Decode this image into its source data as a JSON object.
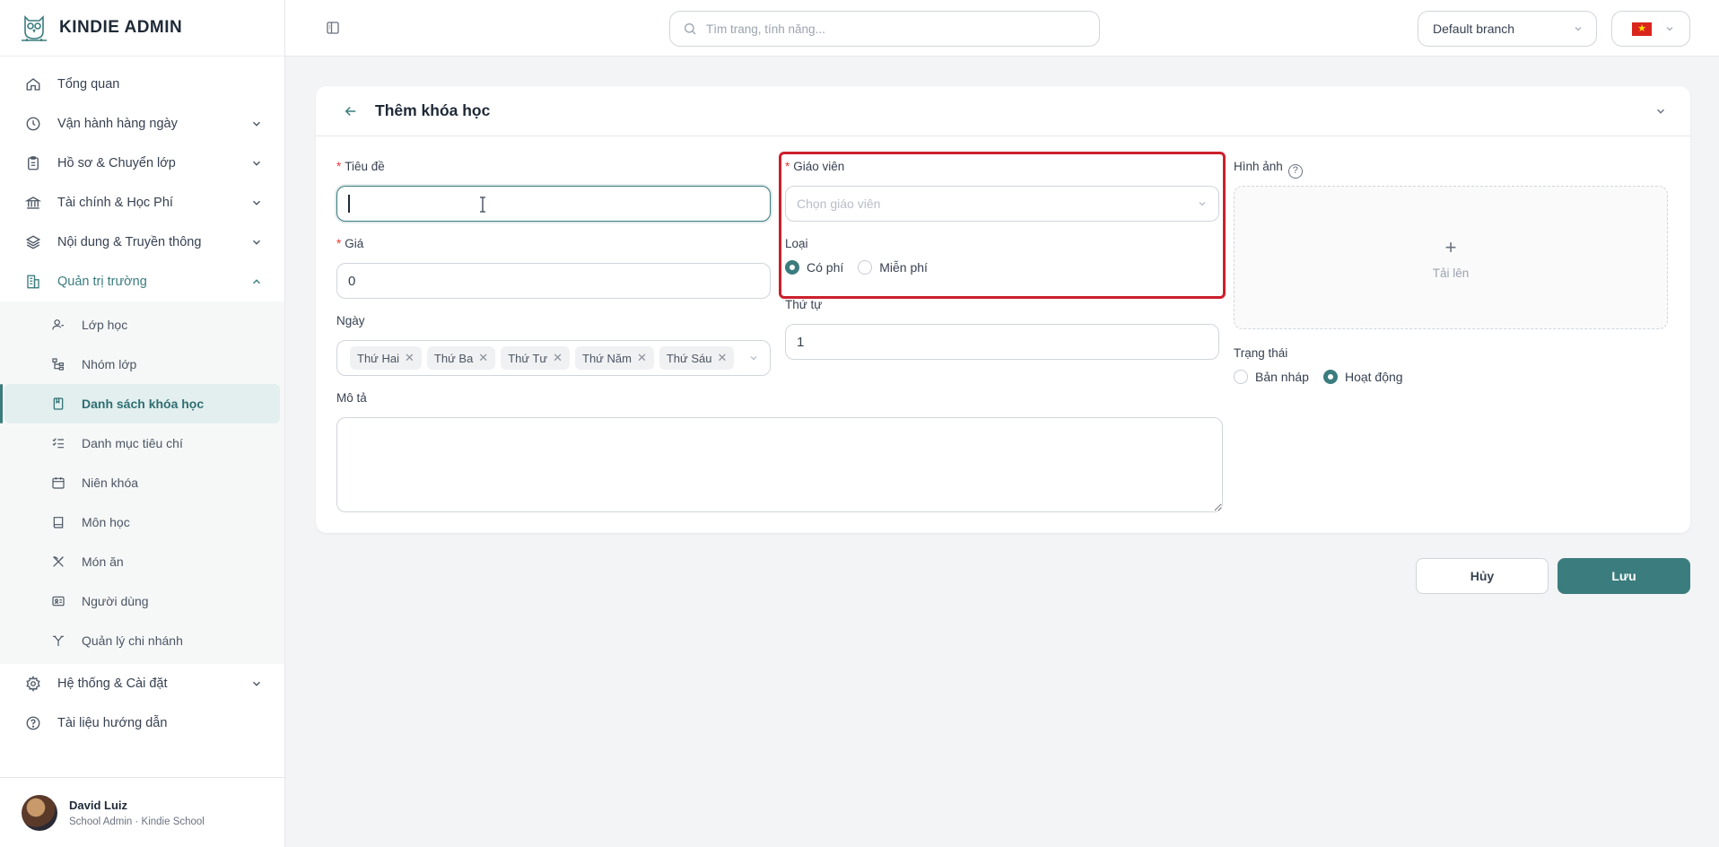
{
  "brand": {
    "name": "KINDIE ADMIN"
  },
  "sidebar": {
    "items": [
      {
        "label": "Tổng quan",
        "icon": "home-icon"
      },
      {
        "label": "Vận hành hàng ngày",
        "icon": "clock-icon"
      },
      {
        "label": "Hồ sơ & Chuyển lớp",
        "icon": "clipboard-icon"
      },
      {
        "label": "Tài chính & Học Phí",
        "icon": "bank-icon"
      },
      {
        "label": "Nội dung & Truyền thông",
        "icon": "layers-icon"
      },
      {
        "label": "Quản trị trường",
        "icon": "building-icon"
      },
      {
        "label": "Hệ thống & Cài đặt",
        "icon": "gear-icon"
      },
      {
        "label": "Tài liệu hướng dẫn",
        "icon": "help-icon"
      }
    ],
    "subitems": [
      {
        "label": "Lớp học",
        "icon": "user-icon"
      },
      {
        "label": "Nhóm lớp",
        "icon": "tree-icon"
      },
      {
        "label": "Danh sách khóa học",
        "icon": "bookmark-icon"
      },
      {
        "label": "Danh mục tiêu chí",
        "icon": "checklist-icon"
      },
      {
        "label": "Niên khóa",
        "icon": "calendar-icon"
      },
      {
        "label": "Môn học",
        "icon": "book-icon"
      },
      {
        "label": "Món ăn",
        "icon": "utensils-icon"
      },
      {
        "label": "Người dùng",
        "icon": "id-card-icon"
      },
      {
        "label": "Quản lý chi nhánh",
        "icon": "branch-icon"
      }
    ]
  },
  "profile": {
    "name": "David Luiz",
    "role": "School Admin · Kindie School"
  },
  "topbar": {
    "search_placeholder": "Tìm trang, tính năng...",
    "branch": "Default branch",
    "language": "vi"
  },
  "form": {
    "title": "Thêm khóa học",
    "title_label": "Tiêu đề",
    "title_value": "",
    "price_label": "Giá",
    "price_value": "0",
    "days_label": "Ngày",
    "days": [
      "Thứ Hai",
      "Thứ Ba",
      "Thứ Tư",
      "Thứ Năm",
      "Thứ Sáu"
    ],
    "description_label": "Mô tả",
    "teacher_label": "Giáo viên",
    "teacher_placeholder": "Chọn giáo viên",
    "type_label": "Loại",
    "type_options": [
      "Có phí",
      "Miễn phí"
    ],
    "type_selected": "Có phí",
    "order_label": "Thứ tự",
    "order_value": "1",
    "image_label": "Hình ảnh",
    "upload_label": "Tải lên",
    "status_label": "Trạng thái",
    "status_options": [
      "Bản nháp",
      "Hoạt động"
    ],
    "status_selected": "Hoạt động"
  },
  "actions": {
    "cancel": "Hủy",
    "save": "Lưu"
  },
  "colors": {
    "accent": "#3b7c7e",
    "highlight": "#cc1f2b",
    "required": "#e53935"
  }
}
